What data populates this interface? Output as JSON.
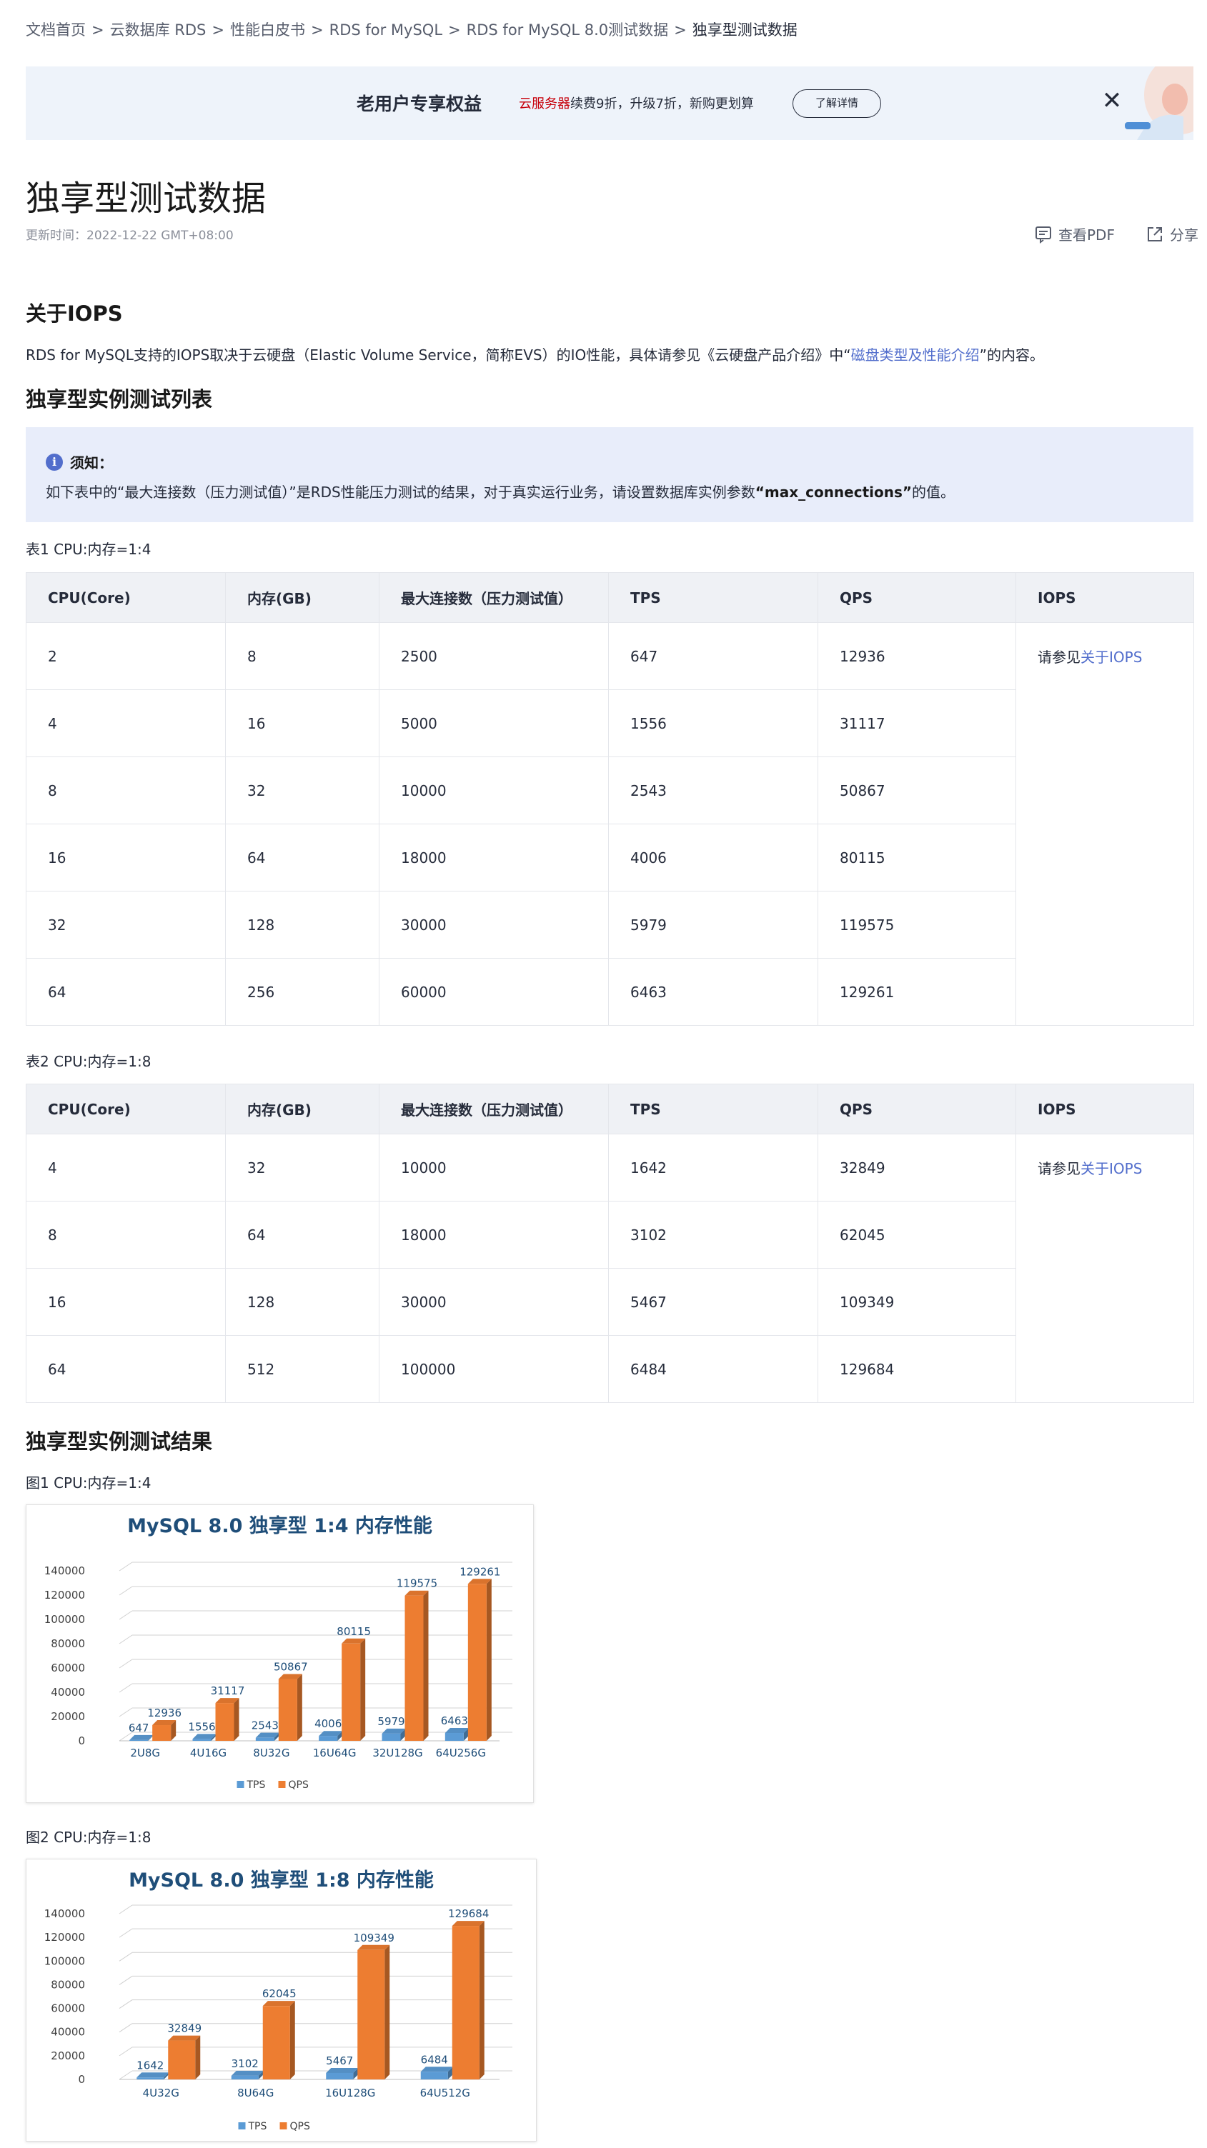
{
  "breadcrumb": {
    "items": [
      "文档首页",
      "云数据库 RDS",
      "性能白皮书",
      "RDS for MySQL",
      "RDS for MySQL 8.0测试数据"
    ],
    "current": "独享型测试数据",
    "separator": ">"
  },
  "banner": {
    "title": "老用户专享权益",
    "desc_highlight": "云服务器",
    "desc_rest": "续费9折，升级7折，新购更划算",
    "button": "了解详情",
    "close": "✕"
  },
  "page": {
    "title": "独享型测试数据",
    "updated": "更新时间：2022-12-22 GMT+08:00",
    "view_pdf": "查看PDF",
    "share": "分享"
  },
  "iops_section": {
    "heading": "关于IOPS",
    "text_before": "RDS for MySQL支持的IOPS取决于云硬盘（Elastic Volume Service，简称EVS）的IO性能，具体请参见《云硬盘产品介绍》中“",
    "link": "磁盘类型及性能介绍",
    "text_after": "”的内容。"
  },
  "list_section": {
    "heading": "独享型实例测试列表",
    "notice_title": "须知：",
    "notice_before": "如下表中的“最大连接数（压力测试值）”是RDS性能压力测试的结果，对于真实运行业务，请设置数据库实例参数",
    "notice_bold": "“max_connections”",
    "notice_after": "的值。"
  },
  "table1": {
    "caption": "表1 CPU:内存=1:4",
    "headers": [
      "CPU(Core)",
      "内存(GB)",
      "最大连接数（压力测试值）",
      "TPS",
      "QPS",
      "IOPS"
    ],
    "rows": [
      [
        "2",
        "8",
        "2500",
        "647",
        "12936"
      ],
      [
        "4",
        "16",
        "5000",
        "1556",
        "31117"
      ],
      [
        "8",
        "32",
        "10000",
        "2543",
        "50867"
      ],
      [
        "16",
        "64",
        "18000",
        "4006",
        "80115"
      ],
      [
        "32",
        "128",
        "30000",
        "5979",
        "119575"
      ],
      [
        "64",
        "256",
        "60000",
        "6463",
        "129261"
      ]
    ],
    "iops_prefix": "请参见",
    "iops_link": "关于IOPS"
  },
  "table2": {
    "caption": "表2 CPU:内存=1:8",
    "headers": [
      "CPU(Core)",
      "内存(GB)",
      "最大连接数（压力测试值）",
      "TPS",
      "QPS",
      "IOPS"
    ],
    "rows": [
      [
        "4",
        "32",
        "10000",
        "1642",
        "32849"
      ],
      [
        "8",
        "64",
        "18000",
        "3102",
        "62045"
      ],
      [
        "16",
        "128",
        "30000",
        "5467",
        "109349"
      ],
      [
        "64",
        "512",
        "100000",
        "6484",
        "129684"
      ]
    ],
    "iops_prefix": "请参见",
    "iops_link": "关于IOPS"
  },
  "results_section": {
    "heading": "独享型实例测试结果",
    "fig1_caption": "图1 CPU:内存=1:4",
    "fig2_caption": "图2 CPU:内存=1:8"
  },
  "colors": {
    "link": "#526ecc",
    "tps": "#5b9bd5",
    "qps": "#ed7d31",
    "chart_title": "#1f4e79",
    "highlight_red": "#c7000b"
  },
  "chart_data": [
    {
      "type": "bar",
      "title": "MySQL 8.0 独享型 1:4 内存性能",
      "categories": [
        "2U8G",
        "4U16G",
        "8U32G",
        "16U64G",
        "32U128G",
        "64U256G"
      ],
      "series": [
        {
          "name": "TPS",
          "values": [
            647,
            1556,
            2543,
            4006,
            5979,
            6463
          ]
        },
        {
          "name": "QPS",
          "values": [
            12936,
            31117,
            50867,
            80115,
            119575,
            129261
          ]
        }
      ],
      "yticks": [
        "0",
        "20000",
        "40000",
        "60000",
        "80000",
        "100000",
        "120000",
        "140000"
      ],
      "ylim": [
        0,
        140000
      ],
      "grid": true,
      "legend": "bottom"
    },
    {
      "type": "bar",
      "title": "MySQL 8.0 独享型 1:8 内存性能",
      "categories": [
        "4U32G",
        "8U64G",
        "16U128G",
        "64U512G"
      ],
      "series": [
        {
          "name": "TPS",
          "values": [
            1642,
            3102,
            5467,
            6484
          ]
        },
        {
          "name": "QPS",
          "values": [
            32849,
            62045,
            109349,
            129684
          ]
        }
      ],
      "yticks": [
        "0",
        "20000",
        "40000",
        "60000",
        "80000",
        "100000",
        "120000",
        "140000"
      ],
      "ylim": [
        0,
        140000
      ],
      "grid": true,
      "legend": "bottom"
    }
  ]
}
